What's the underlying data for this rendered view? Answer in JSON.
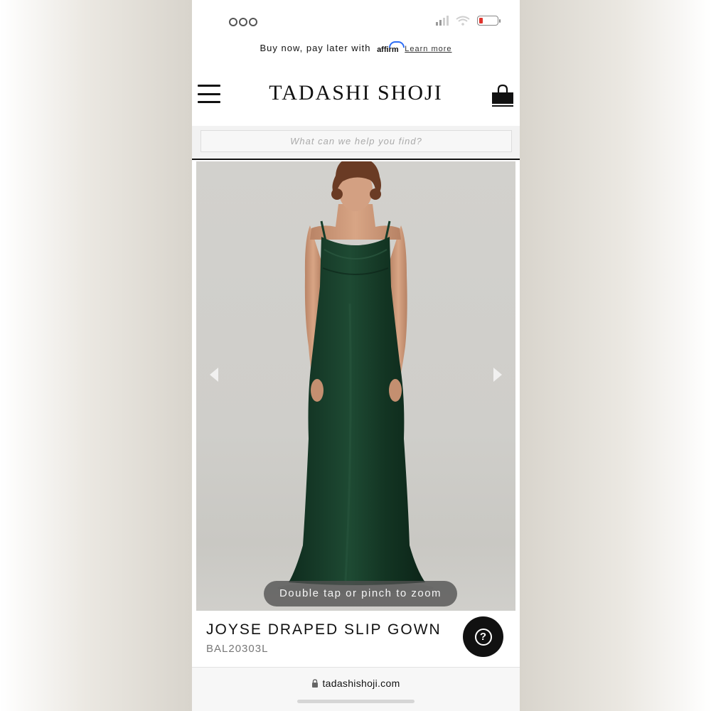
{
  "status_bar": {
    "battery_level": 0.2,
    "battery_color": "#e0342d",
    "icons": [
      "signal-icon",
      "wifi-icon",
      "battery-icon"
    ]
  },
  "promo": {
    "text": "Buy now, pay later with",
    "brand": "affirm",
    "link": "Learn more"
  },
  "header": {
    "logo": "TADASHI SHOJI",
    "icons": [
      "menu-icon",
      "shopping-bag-icon"
    ]
  },
  "search": {
    "placeholder": "What can we help you find?",
    "value": ""
  },
  "gallery": {
    "zoom_hint": "Double tap or pinch to zoom",
    "icons": [
      "chevron-left-icon",
      "chevron-right-icon"
    ],
    "dress_color": "#173d2a"
  },
  "product": {
    "name": "JOYSE DRAPED SLIP GOWN",
    "sku": "BAL20303L"
  },
  "help": {
    "icon": "question-icon"
  },
  "browser": {
    "url": "tadashishoji.com",
    "icon": "lock-icon"
  }
}
